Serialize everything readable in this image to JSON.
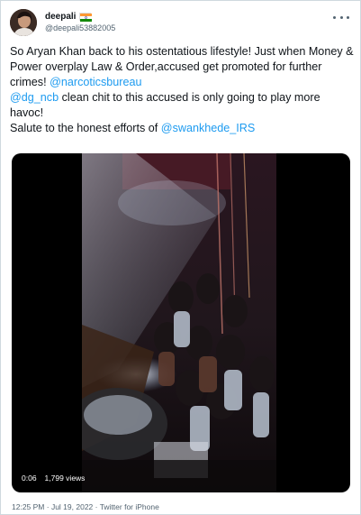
{
  "author": {
    "name": "deepali",
    "handle": "@deepali53882005",
    "flag_icon": "india-flag-icon"
  },
  "tweet": {
    "text_1": "So Aryan Khan back to his ostentatious lifestyle! Just when Money & Power overplay Law & Order,accused get promoted for further crimes! ",
    "mention_1": "@narcoticsbureau",
    "text_2": "\n",
    "mention_2": "@dg_ncb",
    "text_3": " clean chit to this accused is only going to play more havoc!\nSalute to the honest efforts of ",
    "mention_3": "@swankhede_IRS"
  },
  "video": {
    "duration": "0:06",
    "views": "1,799 views"
  },
  "footer": {
    "time": "12:25 PM",
    "separator_1": " · ",
    "date": "Jul 19, 2022",
    "separator_2": " · ",
    "source": "Twitter for iPhone"
  },
  "colors": {
    "link": "#1d9bf0",
    "text": "#0f1419",
    "muted": "#536471"
  }
}
